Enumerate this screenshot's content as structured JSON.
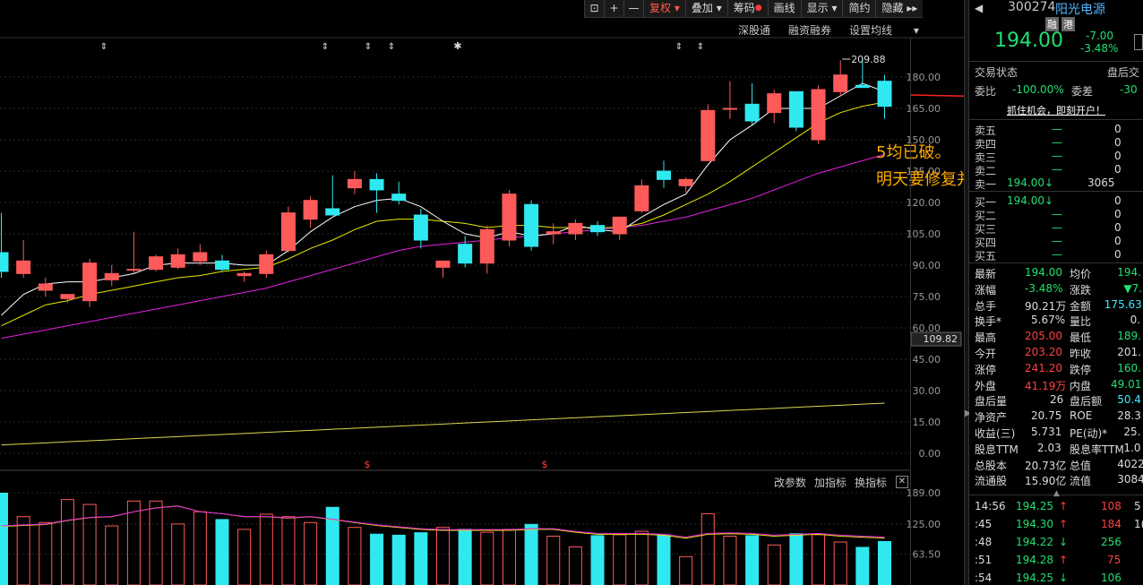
{
  "toolbar": {
    "items": [
      "⊡",
      "+",
      "—",
      "复权",
      "叠加",
      "筹码",
      "画线",
      "显示",
      "简约",
      "隐藏"
    ]
  },
  "top_links": [
    "深股通",
    "融资融券",
    "设置均线"
  ],
  "sub_links": [
    "改参数",
    "加指标",
    "换指标"
  ],
  "price_axis": [
    "180.00",
    "165.00",
    "150.00",
    "135.00",
    "120.00",
    "105.00",
    "90.00",
    "75.00",
    "60.00",
    "45.00",
    "30.00",
    "15.00",
    "0.00"
  ],
  "current_price_tag": "109.82",
  "high_marker": "209.88",
  "vol_axis": [
    "189.00",
    "125.00",
    "63.50"
  ],
  "annotation": {
    "line1": "5均已破。",
    "line2": "明天要修复并站上"
  },
  "stock": {
    "code": "300274",
    "name": "阳光电源",
    "badges": [
      "融",
      "港"
    ],
    "price": "194.00",
    "change": "-7.00",
    "change_pct": "-3.48%"
  },
  "status": {
    "label": "交易状态",
    "value": "盘后交",
    "weibi_label": "委比",
    "weibi": "-100.00%",
    "weicha_label": "委差",
    "weicha": "-30",
    "promo": "抓住机会，即刻开户！"
  },
  "order_book": [
    {
      "label": "卖五",
      "price": "—",
      "vol": "0"
    },
    {
      "label": "卖四",
      "price": "—",
      "vol": "0"
    },
    {
      "label": "卖三",
      "price": "—",
      "vol": "0"
    },
    {
      "label": "卖二",
      "price": "—",
      "vol": "0"
    },
    {
      "label": "卖一",
      "price": "194.00",
      "vol": "3065"
    },
    {
      "label": "买一",
      "price": "194.00",
      "vol": "0"
    },
    {
      "label": "买二",
      "price": "—",
      "vol": "0"
    },
    {
      "label": "买三",
      "price": "—",
      "vol": "0"
    },
    {
      "label": "买四",
      "price": "—",
      "vol": "0"
    },
    {
      "label": "买五",
      "price": "—",
      "vol": "0"
    }
  ],
  "stats": [
    {
      "l1": "最新",
      "v1": "194.00",
      "c1": "g",
      "l2": "均价",
      "v2": "194.",
      "c2": "g"
    },
    {
      "l1": "涨幅",
      "v1": "-3.48%",
      "c1": "g",
      "l2": "涨跌",
      "v2": "▼7.",
      "c2": "g"
    },
    {
      "l1": "总手",
      "v1": "90.21万",
      "c1": "w",
      "l2": "金额",
      "v2": "175.63",
      "c2": "c"
    },
    {
      "l1": "换手*",
      "v1": "5.67%",
      "c1": "w",
      "l2": "量比",
      "v2": "0.",
      "c2": "w"
    },
    {
      "l1": "最高",
      "v1": "205.00",
      "c1": "r",
      "l2": "最低",
      "v2": "189.",
      "c2": "g"
    },
    {
      "l1": "今开",
      "v1": "203.20",
      "c1": "r",
      "l2": "昨收",
      "v2": "201.",
      "c2": "w"
    },
    {
      "l1": "涨停",
      "v1": "241.20",
      "c1": "r",
      "l2": "跌停",
      "v2": "160.",
      "c2": "g"
    },
    {
      "l1": "外盘",
      "v1": "41.19万",
      "c1": "r",
      "l2": "内盘",
      "v2": "49.01",
      "c2": "g"
    },
    {
      "l1": "盘后量",
      "v1": "26",
      "c1": "w",
      "l2": "盘后额",
      "v2": "50.4",
      "c2": "c"
    },
    {
      "l1": "净资产",
      "v1": "20.75",
      "c1": "w",
      "l2": "ROE",
      "v2": "28.3",
      "c2": "w"
    },
    {
      "l1": "收益(三)",
      "v1": "5.731",
      "c1": "w",
      "l2": "PE(动)*",
      "v2": "25.",
      "c2": "w"
    },
    {
      "l1": "股息TTM",
      "v1": "2.03",
      "c1": "w",
      "l2": "股息率TTM",
      "v2": "1.0",
      "c2": "w"
    },
    {
      "l1": "总股本",
      "v1": "20.73亿",
      "c1": "w",
      "l2": "总值",
      "v2": "4022",
      "c2": "w"
    },
    {
      "l1": "流通股",
      "v1": "15.90亿",
      "c1": "w",
      "l2": "流值",
      "v2": "3084",
      "c2": "w"
    }
  ],
  "ticks": [
    {
      "time": "14:56",
      "price": "194.25",
      "dir": "↑",
      "vol": "108",
      "extra": "5"
    },
    {
      "time": ":45",
      "price": "194.30",
      "dir": "↑",
      "vol": "184",
      "extra": "1("
    },
    {
      "time": ":48",
      "price": "194.22",
      "dir": "↓",
      "vol": "256",
      "extra": ""
    },
    {
      "time": ":51",
      "price": "194.28",
      "dir": "↑",
      "vol": "75",
      "extra": ""
    },
    {
      "time": ":54",
      "price": "194.25",
      "dir": "↓",
      "vol": "106",
      "extra": ""
    }
  ],
  "chart_data": {
    "type": "candlestick",
    "ylim": [
      0,
      190
    ],
    "candles": [
      {
        "o": 96,
        "h": 115,
        "l": 84,
        "c": 87
      },
      {
        "o": 86,
        "h": 102,
        "l": 84,
        "c": 92
      },
      {
        "o": 78,
        "h": 84,
        "l": 75,
        "c": 81
      },
      {
        "o": 74,
        "h": 76,
        "l": 72,
        "c": 76
      },
      {
        "o": 73,
        "h": 93,
        "l": 70,
        "c": 91
      },
      {
        "o": 83,
        "h": 90,
        "l": 80,
        "c": 86
      },
      {
        "o": 88,
        "h": 106,
        "l": 86,
        "c": 88
      },
      {
        "o": 88,
        "h": 95,
        "l": 87,
        "c": 94
      },
      {
        "o": 89,
        "h": 98,
        "l": 88,
        "c": 95
      },
      {
        "o": 92,
        "h": 100,
        "l": 90,
        "c": 96
      },
      {
        "o": 92,
        "h": 95,
        "l": 87,
        "c": 88
      },
      {
        "o": 85,
        "h": 87,
        "l": 82,
        "c": 86
      },
      {
        "o": 86,
        "h": 97,
        "l": 84,
        "c": 95
      },
      {
        "o": 97,
        "h": 118,
        "l": 96,
        "c": 115
      },
      {
        "o": 112,
        "h": 123,
        "l": 108,
        "c": 121
      },
      {
        "o": 117,
        "h": 133,
        "l": 116,
        "c": 114
      },
      {
        "o": 127,
        "h": 135,
        "l": 124,
        "c": 131
      },
      {
        "o": 131,
        "h": 134,
        "l": 115,
        "c": 126
      },
      {
        "o": 124,
        "h": 130,
        "l": 119,
        "c": 121
      },
      {
        "o": 114,
        "h": 117,
        "l": 98,
        "c": 102
      },
      {
        "o": 89,
        "h": 92,
        "l": 84,
        "c": 92
      },
      {
        "o": 100,
        "h": 104,
        "l": 89,
        "c": 91
      },
      {
        "o": 91,
        "h": 109,
        "l": 86,
        "c": 107
      },
      {
        "o": 102,
        "h": 126,
        "l": 99,
        "c": 124
      },
      {
        "o": 119,
        "h": 121,
        "l": 97,
        "c": 99
      },
      {
        "o": 105,
        "h": 110,
        "l": 100,
        "c": 106
      },
      {
        "o": 105,
        "h": 112,
        "l": 102,
        "c": 110
      },
      {
        "o": 109,
        "h": 111,
        "l": 104,
        "c": 106
      },
      {
        "o": 105,
        "h": 113,
        "l": 102,
        "c": 113
      },
      {
        "o": 116,
        "h": 131,
        "l": 115,
        "c": 128
      },
      {
        "o": 135,
        "h": 140,
        "l": 127,
        "c": 131
      },
      {
        "o": 128,
        "h": 132,
        "l": 125,
        "c": 131
      },
      {
        "o": 140,
        "h": 167,
        "l": 140,
        "c": 164
      },
      {
        "o": 165,
        "h": 178,
        "l": 160,
        "c": 165
      },
      {
        "o": 167,
        "h": 177,
        "l": 157,
        "c": 159
      },
      {
        "o": 163,
        "h": 174,
        "l": 158,
        "c": 172
      },
      {
        "o": 173,
        "h": 173,
        "l": 154,
        "c": 156
      },
      {
        "o": 150,
        "h": 176,
        "l": 148,
        "c": 174
      },
      {
        "o": 173,
        "h": 188,
        "l": 171,
        "c": 181
      },
      {
        "o": 176,
        "h": 189,
        "l": 175,
        "c": 175
      },
      {
        "o": 178,
        "h": 181,
        "l": 160,
        "c": 166
      }
    ],
    "ma5": [
      66,
      76,
      81,
      82,
      82,
      84,
      86,
      90,
      91,
      91,
      91,
      90,
      90,
      97,
      106,
      113,
      118,
      121,
      122,
      118,
      111,
      105,
      103,
      106,
      104,
      105,
      109,
      107,
      106,
      113,
      119,
      124,
      138,
      150,
      157,
      165,
      165,
      165,
      171,
      177,
      173
    ],
    "ma10": [
      61,
      66,
      71,
      73,
      76,
      78,
      80,
      82,
      84,
      85,
      87,
      88,
      89,
      93,
      98,
      102,
      107,
      111,
      112,
      112,
      111,
      110,
      108,
      109,
      109,
      108,
      108,
      108,
      108,
      110,
      114,
      119,
      124,
      130,
      137,
      144,
      151,
      158,
      163,
      166,
      168
    ],
    "ma20": [
      55,
      57,
      59,
      61,
      63,
      65,
      67,
      69,
      71,
      73,
      75,
      77,
      79,
      82,
      85,
      88,
      91,
      94,
      97,
      99,
      100,
      101,
      102,
      103,
      104,
      105,
      106,
      107,
      108,
      109,
      111,
      113,
      116,
      119,
      122,
      126,
      130,
      134,
      137,
      140,
      143
    ],
    "ma_long": [
      4,
      4.5,
      5,
      5.5,
      6,
      6.5,
      7,
      7.5,
      8,
      8.5,
      9,
      9.5,
      10,
      10.5,
      11,
      11.5,
      12,
      12.5,
      13,
      13.5,
      14,
      14.5,
      15,
      15.5,
      16,
      16.5,
      17,
      17.5,
      18,
      18.5,
      19,
      19.5,
      20,
      20.5,
      21,
      21.5,
      22,
      22.5,
      23,
      23.5,
      24
    ],
    "volume": {
      "ylim": [
        0,
        189
      ],
      "values": [
        189,
        140,
        128,
        175,
        165,
        121,
        172,
        172,
        125,
        150,
        135,
        114,
        145,
        140,
        128,
        160,
        118,
        105,
        103,
        108,
        118,
        115,
        108,
        114,
        125,
        100,
        78,
        102,
        103,
        110,
        104,
        58,
        146,
        100,
        102,
        82,
        106,
        103,
        88,
        78,
        90
      ],
      "ma": [
        120,
        122,
        124,
        132,
        138,
        140,
        150,
        158,
        162,
        150,
        146,
        140,
        140,
        137,
        140,
        134,
        128,
        122,
        118,
        114,
        112,
        112,
        112,
        112,
        114,
        114,
        108,
        104,
        104,
        104,
        102,
        96,
        104,
        105,
        104,
        100,
        102,
        104,
        100,
        98,
        96
      ]
    }
  }
}
